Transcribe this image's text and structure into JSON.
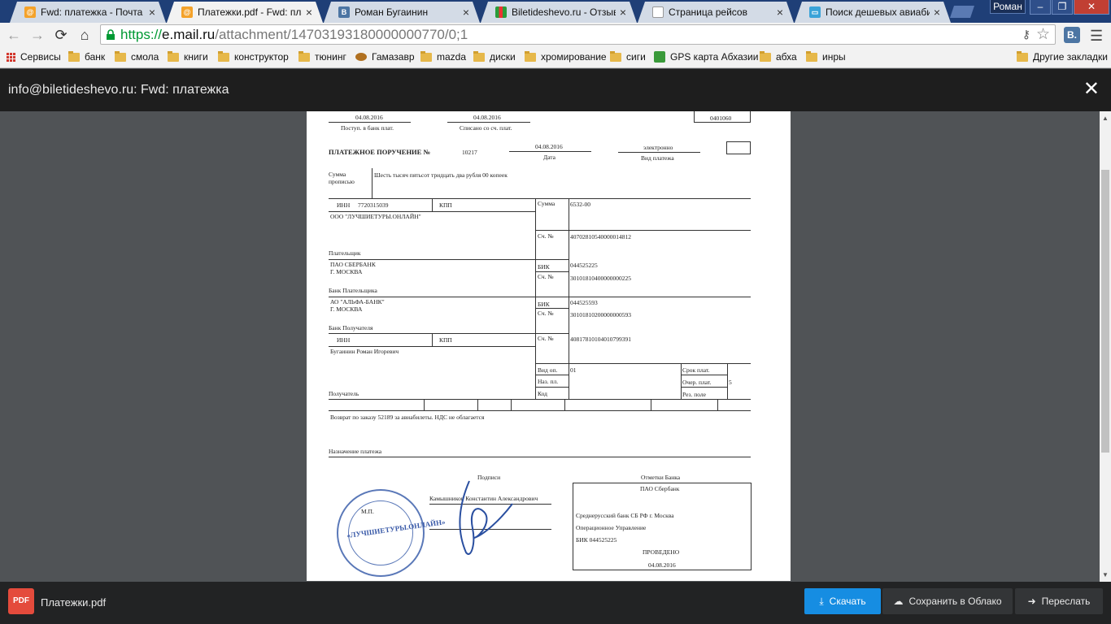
{
  "tabs": [
    {
      "title": "Fwd: платежка - Почта Ma",
      "icon": "mail-at-icon",
      "active": false
    },
    {
      "title": "Платежки.pdf - Fwd: плате",
      "icon": "mail-at-icon",
      "active": true
    },
    {
      "title": "Роман Бугаинин",
      "icon": "vk-icon",
      "active": false
    },
    {
      "title": "Biletideshevo.ru - Отзывы о",
      "icon": "bars-icon",
      "active": false
    },
    {
      "title": "Страница рейсов",
      "icon": "page-icon",
      "active": false
    },
    {
      "title": "Поиск дешевых авиабилет",
      "icon": "search-page-icon",
      "active": false
    }
  ],
  "profile": "Роман",
  "address": {
    "https": "https://",
    "host": "e.mail.ru",
    "path": "/attachment/14703193180000000770/0;1"
  },
  "bookmarks": [
    {
      "label": "Сервисы",
      "type": "apps"
    },
    {
      "label": "банк",
      "type": "folder"
    },
    {
      "label": "смола",
      "type": "folder"
    },
    {
      "label": "книги",
      "type": "folder"
    },
    {
      "label": "конструктор",
      "type": "folder"
    },
    {
      "label": "тюнинг",
      "type": "folder"
    },
    {
      "label": "Гамазавр",
      "type": "site"
    },
    {
      "label": "mazda",
      "type": "folder"
    },
    {
      "label": "диски",
      "type": "folder"
    },
    {
      "label": "хромирование",
      "type": "folder"
    },
    {
      "label": "сиги",
      "type": "folder"
    },
    {
      "label": "GPS карта Абхазии",
      "type": "site"
    },
    {
      "label": "абха",
      "type": "folder"
    },
    {
      "label": "инры",
      "type": "folder"
    }
  ],
  "other_bookmarks": "Другие закладки",
  "viewer": {
    "title": "info@biletideshevo.ru: Fwd: платежка",
    "close": "✕"
  },
  "doc": {
    "date_received": "04.08.2016",
    "received_label": "Поступ. в банк плат.",
    "date_debited": "04.08.2016",
    "debited_label": "Списано со сч. плат.",
    "form_code": "0401060",
    "title": "ПЛАТЕЖНОЕ ПОРУЧЕНИЕ №",
    "number": "10217",
    "date": "04.08.2016",
    "date_label": "Дата",
    "payment_kind": "электронно",
    "payment_kind_label": "Вид платежа",
    "amount_words_label1": "Сумма",
    "amount_words_label2": "прописью",
    "amount_words": "Шесть тысяч пятьсот тридцать два рубля 00 копеек",
    "inn_label": "ИНН",
    "payer_inn": "7720315039",
    "kpp_label": "КПП",
    "sum_label": "Сумма",
    "sum": "6532-00",
    "payer_name": "ООО \"ЛУЧШИЕТУРЫ.ОНЛАЙН\"",
    "account_label": "Сч. №",
    "payer_account": "40702810540000014812",
    "payer_label": "Плательщик",
    "payer_bank": "ПАО СБЕРБАНК",
    "payer_bank_city": "Г. МОСКВА",
    "bik_label": "БИК",
    "payer_bik": "044525225",
    "payer_corr": "30101810400000000225",
    "payer_bank_label": "Банк Плательщика",
    "recv_bank": "АО \"АЛЬФА-БАНК\"",
    "recv_bank_city": "Г. МОСКВА",
    "recv_bik": "044525593",
    "recv_corr": "30101810200000000593",
    "recv_bank_label": "Банк Получателя",
    "recv_account": "40817810104010799391",
    "recipient": "Бугаинин Роман Игоревич",
    "recipient_label": "Получатель",
    "op_type_label": "Вид оп.",
    "op_type": "01",
    "purpose_code_label": "Наз. пл.",
    "code_label": "Код",
    "term_label": "Срок плат.",
    "order_label": "Очер. плат.",
    "order": "5",
    "reserve_label": "Рез. поле",
    "purpose": "Возврат по заказу 52189 за авиабилеты. НДС не облагается",
    "purpose_label": "Назначение платежа",
    "signatures_label": "Подписи",
    "mp_label": "М.П.",
    "signer": "Камышников Константин Александрович",
    "bank_marks_label": "Отметки Банка",
    "bank_marks_title": "ПАО Сбербанк",
    "bank_marks_1": "Среднерусский банк СБ РФ г. Москва",
    "bank_marks_2": "Операционное Управление",
    "bank_marks_3": "БИК 044525225",
    "bank_marks_status": "ПРОВЕДЕНО",
    "bank_marks_date": "04.08.2016"
  },
  "footer": {
    "file_label": "PDF",
    "file_name": "Платежки.pdf",
    "download": "Скачать",
    "save_cloud": "Сохранить в Облако",
    "forward": "Переслать"
  }
}
